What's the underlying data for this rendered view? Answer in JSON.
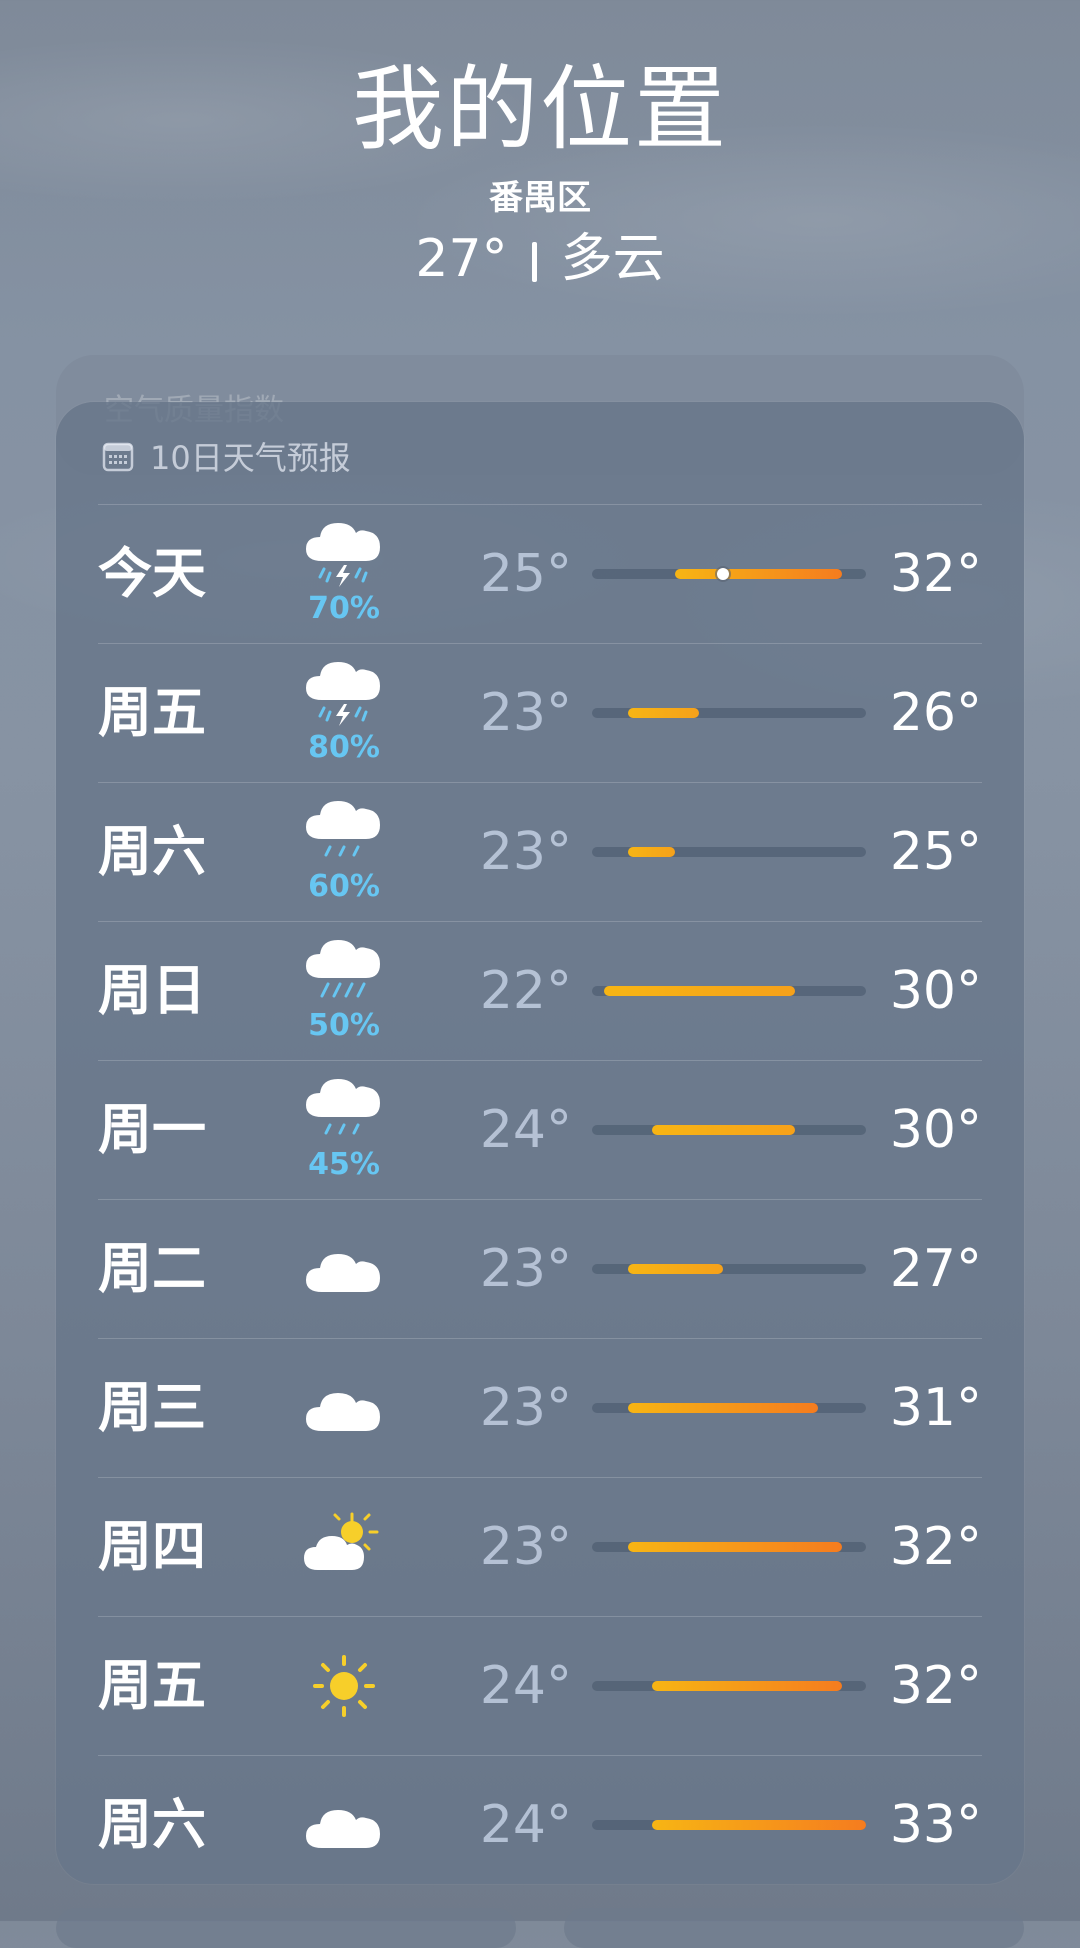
{
  "header": {
    "title": "我的位置",
    "district": "番禺区",
    "current_temp": "27°",
    "condition": "多云"
  },
  "aqi_card": {
    "label": "空气质量指数"
  },
  "forecast": {
    "title": "10日天气预报",
    "days": [
      {
        "day": "今天",
        "icon": "thunderstorm-icon",
        "precip": "70%",
        "low": "25°",
        "high": "32°",
        "low_val": 25,
        "high_val": 32,
        "now": 27
      },
      {
        "day": "周五",
        "icon": "thunderstorm-icon",
        "precip": "80%",
        "low": "23°",
        "high": "26°",
        "low_val": 23,
        "high_val": 26
      },
      {
        "day": "周六",
        "icon": "rain-icon",
        "precip": "60%",
        "low": "23°",
        "high": "25°",
        "low_val": 23,
        "high_val": 25
      },
      {
        "day": "周日",
        "icon": "heavy-rain-icon",
        "precip": "50%",
        "low": "22°",
        "high": "30°",
        "low_val": 22,
        "high_val": 30
      },
      {
        "day": "周一",
        "icon": "rain-icon",
        "precip": "45%",
        "low": "24°",
        "high": "30°",
        "low_val": 24,
        "high_val": 30
      },
      {
        "day": "周二",
        "icon": "cloud-icon",
        "precip": "",
        "low": "23°",
        "high": "27°",
        "low_val": 23,
        "high_val": 27
      },
      {
        "day": "周三",
        "icon": "cloud-icon",
        "precip": "",
        "low": "23°",
        "high": "31°",
        "low_val": 23,
        "high_val": 31
      },
      {
        "day": "周四",
        "icon": "partly-sunny-icon",
        "precip": "",
        "low": "23°",
        "high": "32°",
        "low_val": 23,
        "high_val": 32
      },
      {
        "day": "周五",
        "icon": "sun-icon",
        "precip": "",
        "low": "24°",
        "high": "32°",
        "low_val": 24,
        "high_val": 32
      },
      {
        "day": "周六",
        "icon": "cloud-icon",
        "precip": "",
        "low": "24°",
        "high": "33°",
        "low_val": 24,
        "high_val": 33
      }
    ],
    "range_min": 21.5,
    "range_max": 33
  },
  "colors": {
    "precip": "#67c6f2",
    "bar_cool": "#f7b514",
    "bar_warm": "#f57c1f"
  }
}
